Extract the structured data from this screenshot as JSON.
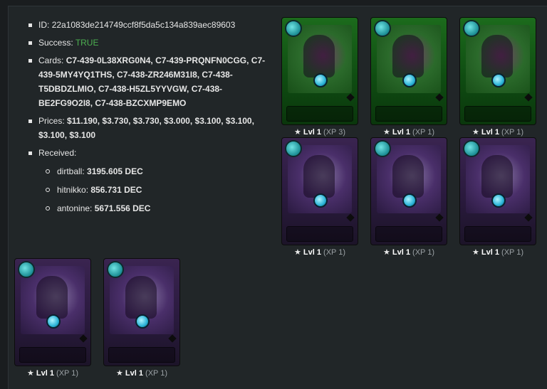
{
  "info": {
    "id_label": "ID:",
    "id_value": "22a1083de214749ccf8f5da5c134a839aec89603",
    "success_label": "Success:",
    "success_value": "TRUE",
    "cards_label": "Cards:",
    "cards_value": "C7-439-0L38XRG0N4, C7-439-PRQNFN0CGG, C7-439-5MY4YQ1THS, C7-438-ZR246M31I8, C7-438-T5DBDZLMIO, C7-438-H5ZL5YYVGW, C7-438-BE2FG9O2I8, C7-438-BZCXMP9EMO",
    "prices_label": "Prices:",
    "prices_value": "$11.190, $3.730, $3.730, $3.000, $3.100, $3.100, $3.100, $3.100",
    "received_label": "Received:",
    "received": [
      {
        "name": "dirtball:",
        "amount": "3195.605 DEC"
      },
      {
        "name": "hitnikko:",
        "amount": "856.731 DEC"
      },
      {
        "name": "antonine:",
        "amount": "5671.556 DEC"
      }
    ]
  },
  "cards": [
    {
      "variant": "green",
      "icon": "star-icon",
      "level": "Lvl 1",
      "xp": "(XP 3)"
    },
    {
      "variant": "green",
      "icon": "star-icon",
      "level": "Lvl 1",
      "xp": "(XP 1)"
    },
    {
      "variant": "green",
      "icon": "star-icon",
      "level": "Lvl 1",
      "xp": "(XP 1)"
    },
    {
      "variant": "purple",
      "icon": "star-icon",
      "level": "Lvl 1",
      "xp": "(XP 1)"
    },
    {
      "variant": "purple",
      "icon": "star-icon",
      "level": "Lvl 1",
      "xp": "(XP 1)"
    },
    {
      "variant": "purple",
      "icon": "star-icon",
      "level": "Lvl 1",
      "xp": "(XP 1)"
    },
    {
      "variant": "purple",
      "icon": "star-icon",
      "level": "Lvl 1",
      "xp": "(XP 1)"
    },
    {
      "variant": "purple",
      "icon": "star-icon",
      "level": "Lvl 1",
      "xp": "(XP 1)"
    }
  ],
  "colors": {
    "success": "#4caf50",
    "background": "#1a1d1f",
    "panel": "#212628"
  }
}
